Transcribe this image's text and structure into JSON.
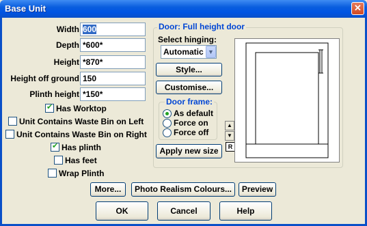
{
  "window": {
    "title": "Base Unit",
    "close_glyph": "✕"
  },
  "fields": {
    "width": {
      "label": "Width",
      "value": "600"
    },
    "depth": {
      "label": "Depth",
      "value": "*600*"
    },
    "height": {
      "label": "Height",
      "value": "*870*"
    },
    "height_off_ground": {
      "label": "Height off ground",
      "value": "150"
    },
    "plinth_height": {
      "label": "Plinth height",
      "value": "*150*"
    }
  },
  "checkboxes": {
    "has_worktop": {
      "label": "Has Worktop",
      "checked": true
    },
    "waste_left": {
      "label": "Unit Contains Waste Bin on Left",
      "checked": false
    },
    "waste_right": {
      "label": "Unit Contains Waste Bin on Right",
      "checked": false
    },
    "has_plinth": {
      "label": "Has plinth",
      "checked": true
    },
    "has_feet": {
      "label": "Has feet",
      "checked": false
    },
    "wrap_plinth": {
      "label": "Wrap Plinth",
      "checked": false
    }
  },
  "door_group": {
    "title": "Door: Full height door",
    "hinging_label": "Select hinging:",
    "hinging_value": "Automatic",
    "style_button": "Style...",
    "customise_button": "Customise...",
    "frame_title": "Door frame:",
    "frame_options": [
      "As default",
      "Force on",
      "Force off"
    ],
    "frame_selected": 0,
    "apply_button": "Apply new size",
    "reset_glyph": "R",
    "nav_left": "◀",
    "nav_right": "▶",
    "nav_up": "▲",
    "nav_down": "▼"
  },
  "bottom_buttons": {
    "more": "More...",
    "photo_realism": "Photo Realism Colours...",
    "preview": "Preview",
    "ok": "OK",
    "cancel": "Cancel",
    "help": "Help"
  },
  "colors": {
    "title_bar": "#0054e3",
    "accent_green": "#21a121",
    "group_title": "#0046d5",
    "close_red": "#d24a22"
  }
}
